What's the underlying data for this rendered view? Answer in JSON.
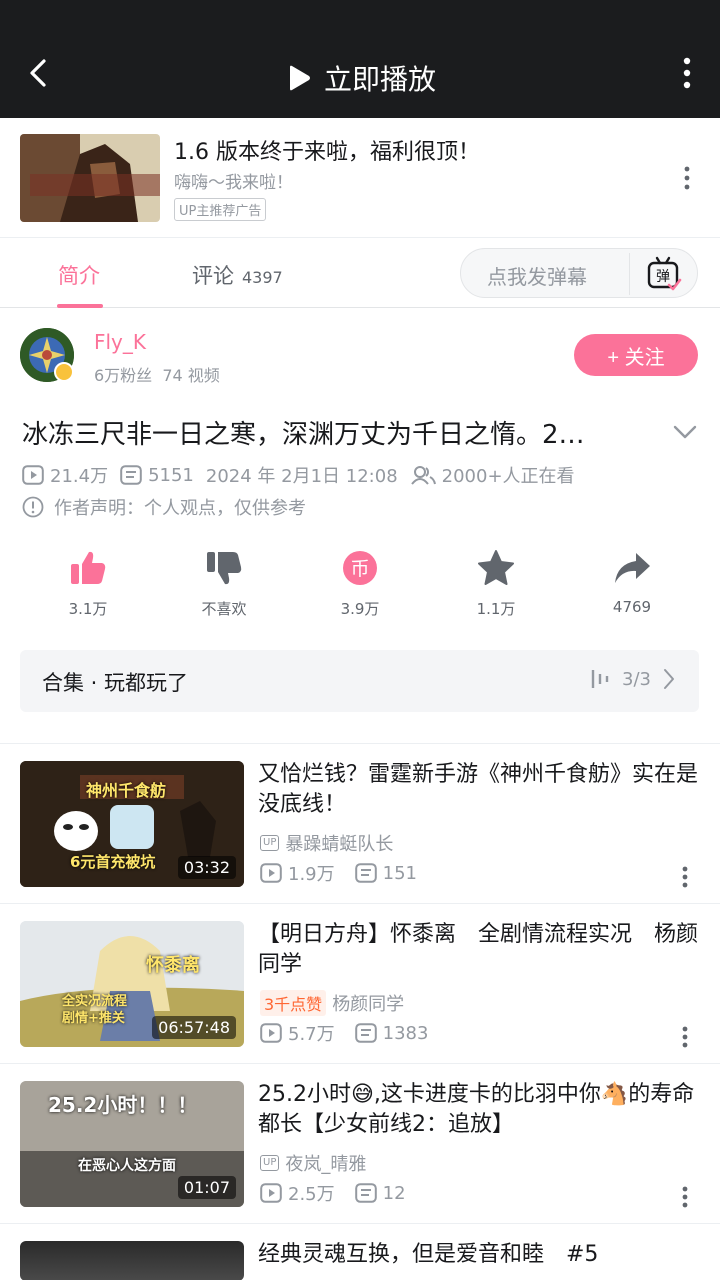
{
  "topbar": {
    "play_label": "立即播放"
  },
  "ad": {
    "title": "1.6 版本终于来啦，福利很顶！",
    "subtitle": "嗨嗨～我来啦！",
    "tag": "UP主推荐广告"
  },
  "tabs": {
    "intro": "简介",
    "comments": "评论",
    "comment_count": "4397",
    "danmu_placeholder": "点我发弹幕",
    "danmu_icon_text": "弹"
  },
  "author": {
    "name": "Fly_K",
    "fans": "6万粉丝",
    "videos": "74 视频",
    "follow_label": "+ 关注"
  },
  "video": {
    "title": "冰冻三尺非一日之寒，深渊万丈为千日之惰。2…",
    "views": "21.4万",
    "danmaku": "5151",
    "date": "2024 年 2月1日 12:08",
    "watching": "2000+人正在看",
    "statement": "作者声明：个人观点，仅供参考"
  },
  "actions": {
    "like": "3.1万",
    "dislike": "不喜欢",
    "coin": "3.9万",
    "coin_icon_text": "币",
    "favorite": "1.1万",
    "share": "4769"
  },
  "collection": {
    "title": "合集 · 玩都玩了",
    "progress": "3/3"
  },
  "recommendations": [
    {
      "title": "又恰烂钱？雷霆新手游《神州千食舫》实在是没底线！",
      "uploader": "暴躁蜻蜓队长",
      "views": "1.9万",
      "danmaku": "151",
      "duration": "03:32",
      "thumb_text_top": "神州千食舫",
      "thumb_text_bottom": "6元首充被坑"
    },
    {
      "title": "【明日方舟】怀黍离　全剧情流程实况　杨颜同学",
      "hot": "3千点赞",
      "uploader": "杨颜同学",
      "views": "5.7万",
      "danmaku": "1383",
      "duration": "06:57:48",
      "thumb_text_top": "怀黍离",
      "thumb_text_bottom": "全实况流程 剧情+推关"
    },
    {
      "title": "25.2小时😅,这卡进度卡的比羽中你🐴的寿命都长【少女前线2：追放】",
      "uploader": "夜岚_晴雅",
      "views": "2.5万",
      "danmaku": "12",
      "duration": "01:07",
      "thumb_text_top": "25.2小时！！！",
      "thumb_text_bottom": "在恶心人这方面"
    },
    {
      "title": "经典灵魂互换，但是爱音和睦　#5"
    }
  ],
  "colors": {
    "accent": "#fb7299",
    "muted": "#9499a0",
    "topbar": "#1b1c1e"
  }
}
